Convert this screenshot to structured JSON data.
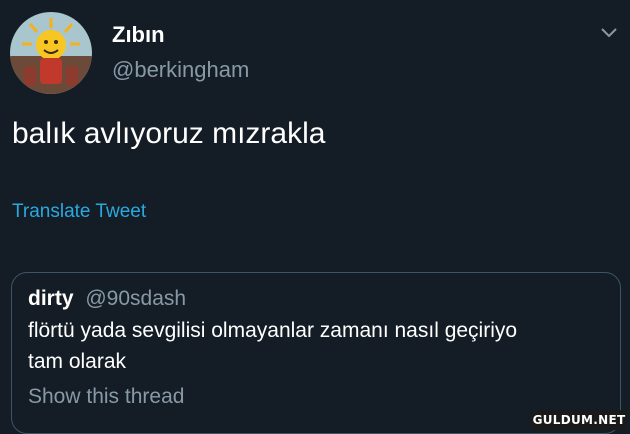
{
  "tweet": {
    "author": {
      "display_name": "Zıbın",
      "handle": "@berkingham",
      "avatar_icon": "sun-character-avatar"
    },
    "menu_icon": "chevron-down-icon",
    "text": "balık avlıyoruz mızrakla",
    "translate_label": "Translate Tweet"
  },
  "quoted_tweet": {
    "author_name": "dirty",
    "author_handle": "@90sdash",
    "text_lines": [
      "flörtü yada sevgilisi olmayanlar zamanı nasıl geçiriyo",
      "tam olarak"
    ],
    "show_thread_label": "Show this thread"
  },
  "watermark": {
    "text": "GULDUM.NET"
  },
  "colors": {
    "background": "#141d26",
    "primary_text": "#ffffff",
    "secondary_text": "#8899a6",
    "link": "#2aa9e0",
    "card_border": "#3d5466"
  }
}
